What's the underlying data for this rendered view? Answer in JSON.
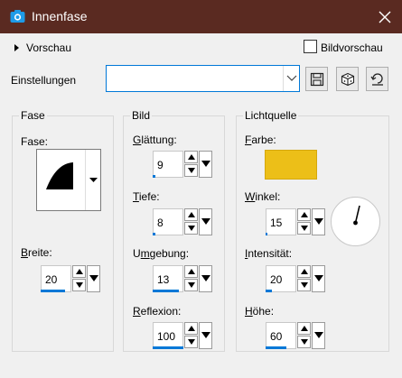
{
  "window": {
    "title": "Innenfase",
    "app_icon": "camera-icon",
    "close_icon": "close-icon"
  },
  "preview": {
    "label": "Vorschau",
    "image_preview_label": "Bildvorschau",
    "image_preview_checked": false
  },
  "settings": {
    "label": "Einstellungen",
    "preset_value": "",
    "buttons": [
      "save-preset-icon",
      "random-dice-icon",
      "reset-icon"
    ]
  },
  "groups": {
    "bevel": {
      "title": "Fase",
      "shape_label": "Fase:",
      "width_label": "Breite:",
      "width_value": "20",
      "width_fraction": 0.8
    },
    "image": {
      "title": "Bild",
      "smoothness_label": "Glättung:",
      "smoothness_value": "9",
      "smoothness_fraction": 0.09,
      "depth_label": "Tiefe:",
      "depth_value": "8",
      "depth_fraction": 0.08,
      "ambience_label": "Umgebung:",
      "ambience_value": "13",
      "ambience_fraction": 0.85,
      "shininess_label": "Reflexion:",
      "shininess_value": "100",
      "shininess_fraction": 1.0
    },
    "light": {
      "title": "Lichtquelle",
      "color_label": "Farbe:",
      "color": "#ecbf18",
      "angle_label": "Winkel:",
      "angle_value": "15",
      "angle_fraction": 0.04,
      "intensity_label": "Intensität:",
      "intensity_value": "20",
      "intensity_fraction": 0.2,
      "elevation_label": "Höhe:",
      "elevation_value": "60",
      "elevation_fraction": 0.67
    }
  },
  "colors": {
    "titlebar": "#5a2a21",
    "accent": "#0078d7",
    "light_color": "#ecbf18"
  }
}
